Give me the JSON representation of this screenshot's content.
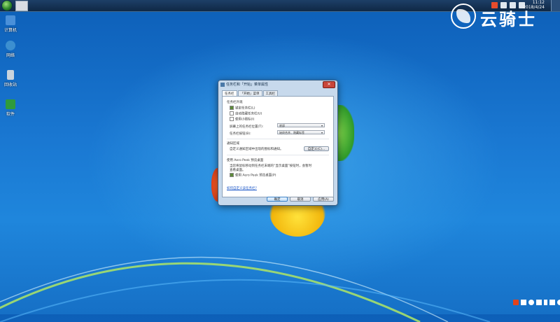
{
  "taskbar": {
    "clock_time": "11:12",
    "clock_date": "2018/4/24"
  },
  "desktop_icons": [
    {
      "label": "计算机",
      "icon": "computer-icon",
      "color": "#4a90d9"
    },
    {
      "label": "网络",
      "icon": "network-icon",
      "color": "#3c8fd0"
    },
    {
      "label": "回收站",
      "icon": "recycle-bin-icon",
      "color": "#c9d3dd"
    },
    {
      "label": "软件",
      "icon": "software-folder-icon",
      "color": "#2f9b3b"
    }
  ],
  "watermark": {
    "text": "云骑士"
  },
  "dialog": {
    "title": "任务栏和「开始」菜单属性",
    "close_label": "✕",
    "tabs": [
      {
        "label": "任务栏",
        "active": true
      },
      {
        "label": "「开始」菜单",
        "active": false
      },
      {
        "label": "工具栏",
        "active": false
      }
    ],
    "appearance_heading": "任务栏外观",
    "options": [
      {
        "label": "锁定任务栏(L)",
        "checked": true
      },
      {
        "label": "自动隐藏任务栏(U)",
        "checked": false
      },
      {
        "label": "使用小图标(I)",
        "checked": false
      }
    ],
    "position_label": "屏幕上的任务栏位置(T):",
    "position_value": "底部",
    "buttons_label": "任务栏按钮(B):",
    "buttons_value": "始终合并、隐藏标签",
    "notification_heading": "通知区域",
    "notification_text": "自定义通知区域中出现的图标和通知。",
    "customize_button": "自定义(C)...",
    "aero_heading": "使用 Aero Peek 预览桌面",
    "aero_desc_line1": "当您将鼠标移动到任务栏末端的“显示桌面”按钮时，会暂时",
    "aero_desc_line2": "查看桌面。",
    "aero_option": {
      "label": "使用 Aero Peek 预览桌面(P)",
      "checked": true
    },
    "help_link": "如何自定义该任务栏?",
    "ok_label": "确定",
    "cancel_label": "取消",
    "apply_label": "应用(A)"
  }
}
